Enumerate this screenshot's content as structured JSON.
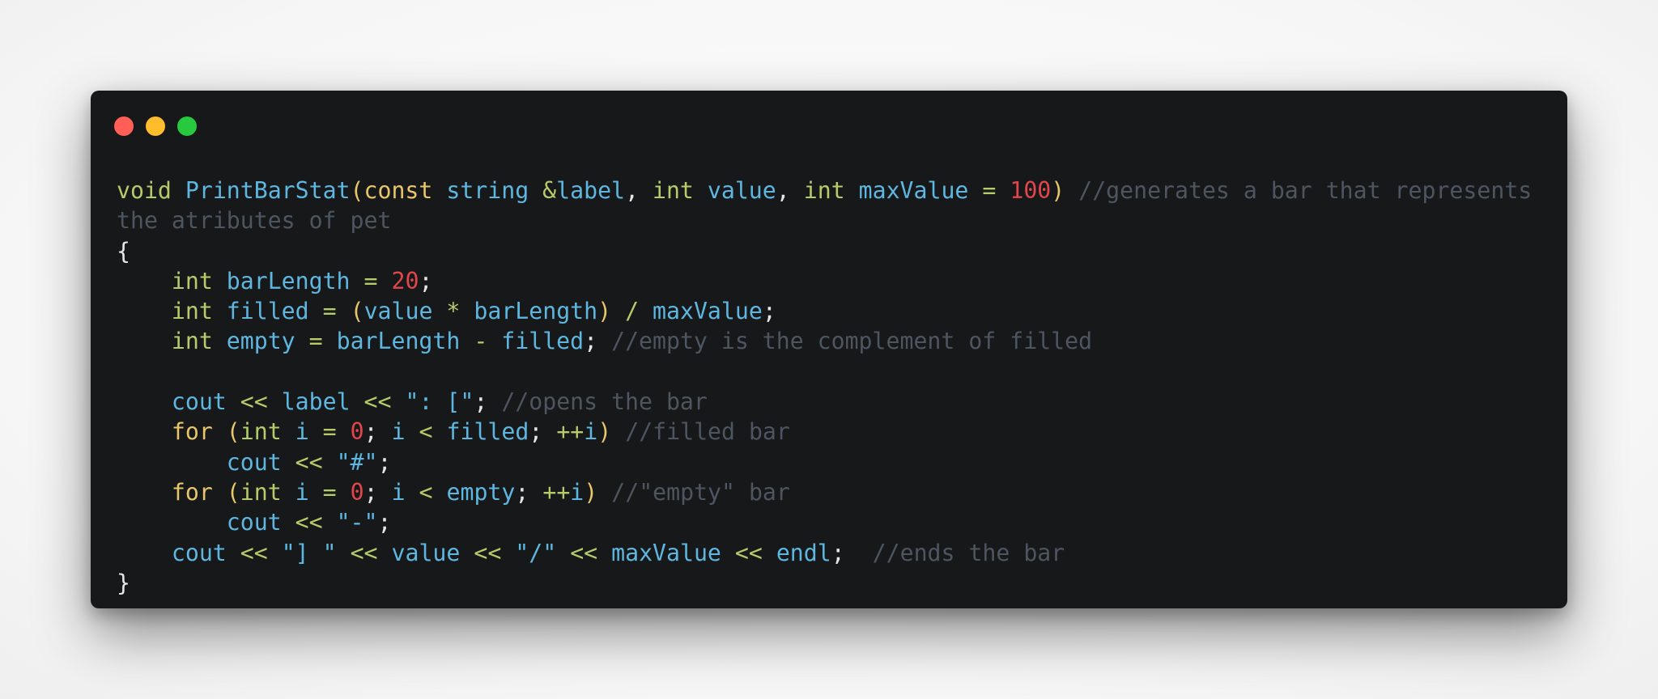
{
  "window": {
    "controls": [
      "close",
      "minimize",
      "maximize"
    ],
    "colors": {
      "close": "#ff5f56",
      "minimize": "#ffbd2e",
      "maximize": "#27c93f",
      "background": "#17181a"
    }
  },
  "code": {
    "language": "cpp",
    "lines": [
      "void PrintBarStat(const string &label, int value, int maxValue = 100) //generates a bar that represents",
      "the atributes of pet",
      "{",
      "    int barLength = 20;",
      "    int filled = (value * barLength) / maxValue;",
      "    int empty = barLength - filled; //empty is the complement of filled",
      "",
      "    cout << label << \": [\"; //opens the bar",
      "    for (int i = 0; i < filled; ++i) //filled bar",
      "        cout << \"#\";",
      "    for (int i = 0; i < empty; ++i) //\"empty\" bar",
      "        cout << \"-\";",
      "    cout << \"] \" << value << \"/\" << maxValue << endl;  //ends the bar",
      "}"
    ]
  }
}
